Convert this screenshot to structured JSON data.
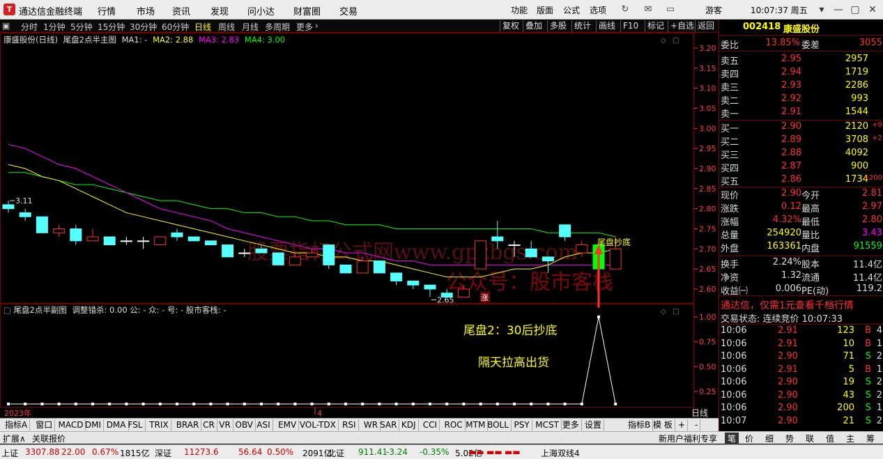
{
  "titlebar": {
    "app_title": "通达信金融终端",
    "menus": [
      "行情",
      "市场",
      "资讯",
      "发现",
      "问小达",
      "财富圈",
      "交易"
    ],
    "right_menus": [
      "功能",
      "版面",
      "公式",
      "选项"
    ],
    "guest": "游客",
    "clock": "10:07:37 周五"
  },
  "toolbar": {
    "periods": [
      "分时",
      "1分钟",
      "5分钟",
      "15分钟",
      "30分钟",
      "60分钟",
      "日线",
      "周线",
      "月线",
      "多周期",
      "更多"
    ],
    "active_period": "日线",
    "right_buttons": [
      "复权",
      "叠加",
      "多股",
      "统计",
      "画线",
      "F10",
      "标记",
      "+自选",
      "返回"
    ]
  },
  "main_chart": {
    "stock_label": "康盛股份(日线)",
    "formula_label": "尾盘2点半主图",
    "ma1_label": "MA1: -",
    "ma2_label": "MA2: 2.88",
    "ma3_label": "MA3: 2.83",
    "ma4_label": "MA4: 3.00",
    "high_marker": "3.11",
    "low_marker": "2.65",
    "signal_label": "尾盘抄底",
    "zhang_badge": "涨",
    "watermark1": "股票指标公式网www.gpzbgs.com",
    "watermark2": "公众号：股市客栈",
    "y_ticks": [
      "3.20",
      "3.15",
      "3.10",
      "3.05",
      "3.00",
      "2.95",
      "2.90",
      "2.85",
      "2.80",
      "2.75",
      "2.70",
      "2.65",
      "2.60"
    ],
    "colors": {
      "up": "#ff3030",
      "down": "#54ffff",
      "ma2": "#ffff00",
      "ma3": "#ff00ff",
      "ma4": "#00ff00",
      "signal": "#00ff00"
    }
  },
  "sub_chart": {
    "title": "尾盘2点半副图",
    "params": "调整错杀: 0.00 公: - 众: - 号: - 股市客栈: -",
    "text1": "尾盘2：30后抄底",
    "text2": "隔天拉高出货",
    "y_ticks": [
      "1.00",
      "0.75",
      "0.50",
      "0.25"
    ],
    "x_label_year": "2023年",
    "x_label_month": "4",
    "period_tag": "日线"
  },
  "chart_data": {
    "type": "candlestick",
    "candles": [
      {
        "o": 2.81,
        "c": 2.8,
        "h": 2.82,
        "l": 2.79
      },
      {
        "o": 2.79,
        "c": 2.78,
        "h": 2.8,
        "l": 2.77
      },
      {
        "o": 2.78,
        "c": 2.74,
        "h": 2.78,
        "l": 2.74
      },
      {
        "o": 2.74,
        "c": 2.75,
        "h": 2.76,
        "l": 2.73
      },
      {
        "o": 2.75,
        "c": 2.72,
        "h": 2.76,
        "l": 2.71
      },
      {
        "o": 2.72,
        "c": 2.73,
        "h": 2.75,
        "l": 2.72
      },
      {
        "o": 2.73,
        "c": 2.71,
        "h": 2.73,
        "l": 2.71
      },
      {
        "o": 2.72,
        "c": 2.72,
        "h": 2.73,
        "l": 2.71
      },
      {
        "o": 2.72,
        "c": 2.72,
        "h": 2.73,
        "l": 2.7
      },
      {
        "o": 2.71,
        "c": 2.73,
        "h": 2.73,
        "l": 2.71
      },
      {
        "o": 2.74,
        "c": 2.73,
        "h": 2.75,
        "l": 2.72
      },
      {
        "o": 2.73,
        "c": 2.72,
        "h": 2.73,
        "l": 2.72
      },
      {
        "o": 2.72,
        "c": 2.71,
        "h": 2.72,
        "l": 2.71
      },
      {
        "o": 2.71,
        "c": 2.68,
        "h": 2.71,
        "l": 2.68
      },
      {
        "o": 2.69,
        "c": 2.69,
        "h": 2.7,
        "l": 2.68
      },
      {
        "o": 2.7,
        "c": 2.69,
        "h": 2.71,
        "l": 2.69
      },
      {
        "o": 2.69,
        "c": 2.66,
        "h": 2.69,
        "l": 2.66
      },
      {
        "o": 2.66,
        "c": 2.68,
        "h": 2.69,
        "l": 2.66
      },
      {
        "o": 2.68,
        "c": 2.69,
        "h": 2.7,
        "l": 2.68
      },
      {
        "o": 2.71,
        "c": 2.66,
        "h": 2.71,
        "l": 2.65
      },
      {
        "o": 2.66,
        "c": 2.64,
        "h": 2.66,
        "l": 2.64
      },
      {
        "o": 2.64,
        "c": 2.67,
        "h": 2.68,
        "l": 2.64
      },
      {
        "o": 2.67,
        "c": 2.64,
        "h": 2.67,
        "l": 2.64
      },
      {
        "o": 2.64,
        "c": 2.62,
        "h": 2.64,
        "l": 2.61
      },
      {
        "o": 2.62,
        "c": 2.61,
        "h": 2.62,
        "l": 2.6
      },
      {
        "o": 2.61,
        "c": 2.6,
        "h": 2.61,
        "l": 2.58
      },
      {
        "o": 2.59,
        "c": 2.58,
        "h": 2.6,
        "l": 2.58
      },
      {
        "o": 2.58,
        "c": 2.6,
        "h": 2.61,
        "l": 2.58
      },
      {
        "o": 2.65,
        "c": 2.72,
        "h": 2.72,
        "l": 2.65
      },
      {
        "o": 2.73,
        "c": 2.72,
        "h": 2.77,
        "l": 2.7
      },
      {
        "o": 2.71,
        "c": 2.71,
        "h": 2.72,
        "l": 2.68
      },
      {
        "o": 2.7,
        "c": 2.68,
        "h": 2.72,
        "l": 2.68
      },
      {
        "o": 2.68,
        "c": 2.67,
        "h": 2.68,
        "l": 2.64
      },
      {
        "o": 2.76,
        "c": 2.73,
        "h": 2.76,
        "l": 2.72
      },
      {
        "o": 2.69,
        "c": 2.71,
        "h": 2.72,
        "l": 2.68
      },
      {
        "o": 2.71,
        "c": 2.65,
        "h": 2.71,
        "l": 2.65
      },
      {
        "o": 2.65,
        "c": 2.7,
        "h": 2.73,
        "l": 2.65
      }
    ],
    "ma2": [
      2.91,
      2.9,
      2.88,
      2.87,
      2.85,
      2.83,
      2.81,
      2.79,
      2.78,
      2.77,
      2.76,
      2.75,
      2.74,
      2.73,
      2.72,
      2.71,
      2.7,
      2.69,
      2.69,
      2.68,
      2.68,
      2.67,
      2.67,
      2.66,
      2.65,
      2.64,
      2.63,
      2.63,
      2.63,
      2.64,
      2.65,
      2.65,
      2.66,
      2.68,
      2.69,
      2.69,
      2.7
    ],
    "ma3": [
      2.96,
      2.95,
      2.93,
      2.91,
      2.9,
      2.88,
      2.86,
      2.84,
      2.82,
      2.8,
      2.79,
      2.78,
      2.77,
      2.75,
      2.74,
      2.73,
      2.72,
      2.71,
      2.7,
      2.7,
      2.69,
      2.69,
      2.68,
      2.67,
      2.67,
      2.66,
      2.66,
      2.66,
      2.66,
      2.66,
      2.66,
      2.66,
      2.66,
      2.66,
      2.66,
      2.66,
      2.66
    ],
    "ma4": [
      2.89,
      2.89,
      2.88,
      2.87,
      2.86,
      2.86,
      2.85,
      2.84,
      2.83,
      2.82,
      2.82,
      2.81,
      2.8,
      2.8,
      2.79,
      2.79,
      2.78,
      2.78,
      2.77,
      2.77,
      2.76,
      2.76,
      2.76,
      2.75,
      2.75,
      2.75,
      2.75,
      2.75,
      2.75,
      2.75,
      2.75,
      2.75,
      2.74,
      2.74,
      2.74,
      2.74,
      2.73
    ],
    "signal_index": 35,
    "signal_values": [
      0,
      0,
      0,
      0,
      0,
      0,
      0,
      0,
      0,
      0,
      0,
      0,
      0,
      0,
      0,
      0,
      0,
      0,
      0,
      0,
      0,
      0,
      0,
      0,
      0,
      0,
      0,
      0,
      0,
      0,
      0,
      0,
      0,
      0,
      0,
      1,
      0
    ]
  },
  "quote": {
    "code": "002418",
    "name": "康盛股份",
    "weibi_label": "委比",
    "weibi": "13.85%",
    "weicha_label": "委差",
    "weicha": "3055",
    "asks": [
      {
        "label": "卖五",
        "price": "2.95",
        "vol": "2957"
      },
      {
        "label": "卖四",
        "price": "2.94",
        "vol": "1719"
      },
      {
        "label": "卖三",
        "price": "2.93",
        "vol": "2286"
      },
      {
        "label": "卖二",
        "price": "2.92",
        "vol": "993"
      },
      {
        "label": "卖一",
        "price": "2.91",
        "vol": "1544"
      }
    ],
    "bids": [
      {
        "label": "买一",
        "price": "2.90",
        "vol": "2120",
        "chg": "+9"
      },
      {
        "label": "买二",
        "price": "2.89",
        "vol": "3708",
        "chg": "+2"
      },
      {
        "label": "买三",
        "price": "2.88",
        "vol": "4092",
        "chg": ""
      },
      {
        "label": "买四",
        "price": "2.87",
        "vol": "900",
        "chg": ""
      },
      {
        "label": "买五",
        "price": "2.86",
        "vol": "1734",
        "chg": "+200"
      }
    ],
    "stats": [
      {
        "l1": "现价",
        "v1": "2.90",
        "l2": "今开",
        "v2": "2.81"
      },
      {
        "l1": "涨跌",
        "v1": "0.12",
        "l2": "最高",
        "v2": "2.97"
      },
      {
        "l1": "涨幅",
        "v1": "4.32%",
        "l2": "最低",
        "v2": "2.80"
      },
      {
        "l1": "总量",
        "v1": "254920",
        "l2": "量比",
        "v2": "3.43"
      },
      {
        "l1": "外盘",
        "v1": "163361",
        "l2": "内盘",
        "v2": "91559"
      }
    ],
    "stats2": [
      {
        "l1": "换手",
        "v1": "2.24%",
        "l2": "股本",
        "v2": "11.4亿"
      },
      {
        "l1": "净资",
        "v1": "1.32",
        "l2": "流通",
        "v2": "11.4亿"
      },
      {
        "l1": "收益㈠",
        "v1": "0.006",
        "l2": "PE(动)",
        "v2": "119.2"
      }
    ],
    "ad": "通达信，仅需1元查看千档行情",
    "trade_status": "交易状态: 连续竞价 10:07:33",
    "ticks": [
      {
        "t": "10:06",
        "p": "2.91",
        "v": "123",
        "d": "B",
        "n": "4"
      },
      {
        "t": "10:06",
        "p": "2.91",
        "v": "10",
        "d": "B",
        "n": "1"
      },
      {
        "t": "10:06",
        "p": "2.90",
        "v": "71",
        "d": "S",
        "n": "2"
      },
      {
        "t": "10:06",
        "p": "2.91",
        "v": "5",
        "d": "B",
        "n": "1"
      },
      {
        "t": "10:06",
        "p": "2.90",
        "v": "19",
        "d": "S",
        "n": "2"
      },
      {
        "t": "10:06",
        "p": "2.90",
        "v": "43",
        "d": "S",
        "n": "2"
      },
      {
        "t": "10:06",
        "p": "2.90",
        "v": "200",
        "d": "S",
        "n": "1"
      },
      {
        "t": "10:07",
        "p": "2.90",
        "v": "21",
        "d": "S",
        "n": "2"
      }
    ]
  },
  "indicator_tabs": [
    "指标A",
    "窗口",
    "MACD",
    "DMI",
    "DMA",
    "FSL",
    "TRIX",
    "BRAR",
    "CR",
    "VR",
    "OBV",
    "ASI",
    "EMV",
    "VOL-TDX",
    "RSI",
    "WR",
    "SAR",
    "KDJ",
    "CCI",
    "ROC",
    "MTM",
    "BOLL",
    "PSY",
    "MCST",
    "更多",
    "设置"
  ],
  "indicator_right": [
    "指标B",
    "模 板",
    "+",
    "-"
  ],
  "bottom2": {
    "left1": "扩展∧",
    "left2": "关联报价",
    "right1": "新用户福利专享",
    "right_tabs": [
      "笔",
      "价",
      "细",
      "势",
      "联",
      "值",
      "主",
      "筹"
    ]
  },
  "statusbar": {
    "items": [
      {
        "name": "上证",
        "val": "3307.88",
        "chg": "22.00",
        "pct": "0.67%",
        "amt": "1815亿"
      },
      {
        "name": "深证",
        "val": "11273.6",
        "chg": "56.64",
        "pct": "0.50%",
        "amt": "2091亿"
      },
      {
        "name": "北证",
        "val": "911.41",
        "chg": "-3.24",
        "pct": "-0.35%",
        "amt": "5.02亿"
      }
    ],
    "right_label": "上海双线4"
  }
}
